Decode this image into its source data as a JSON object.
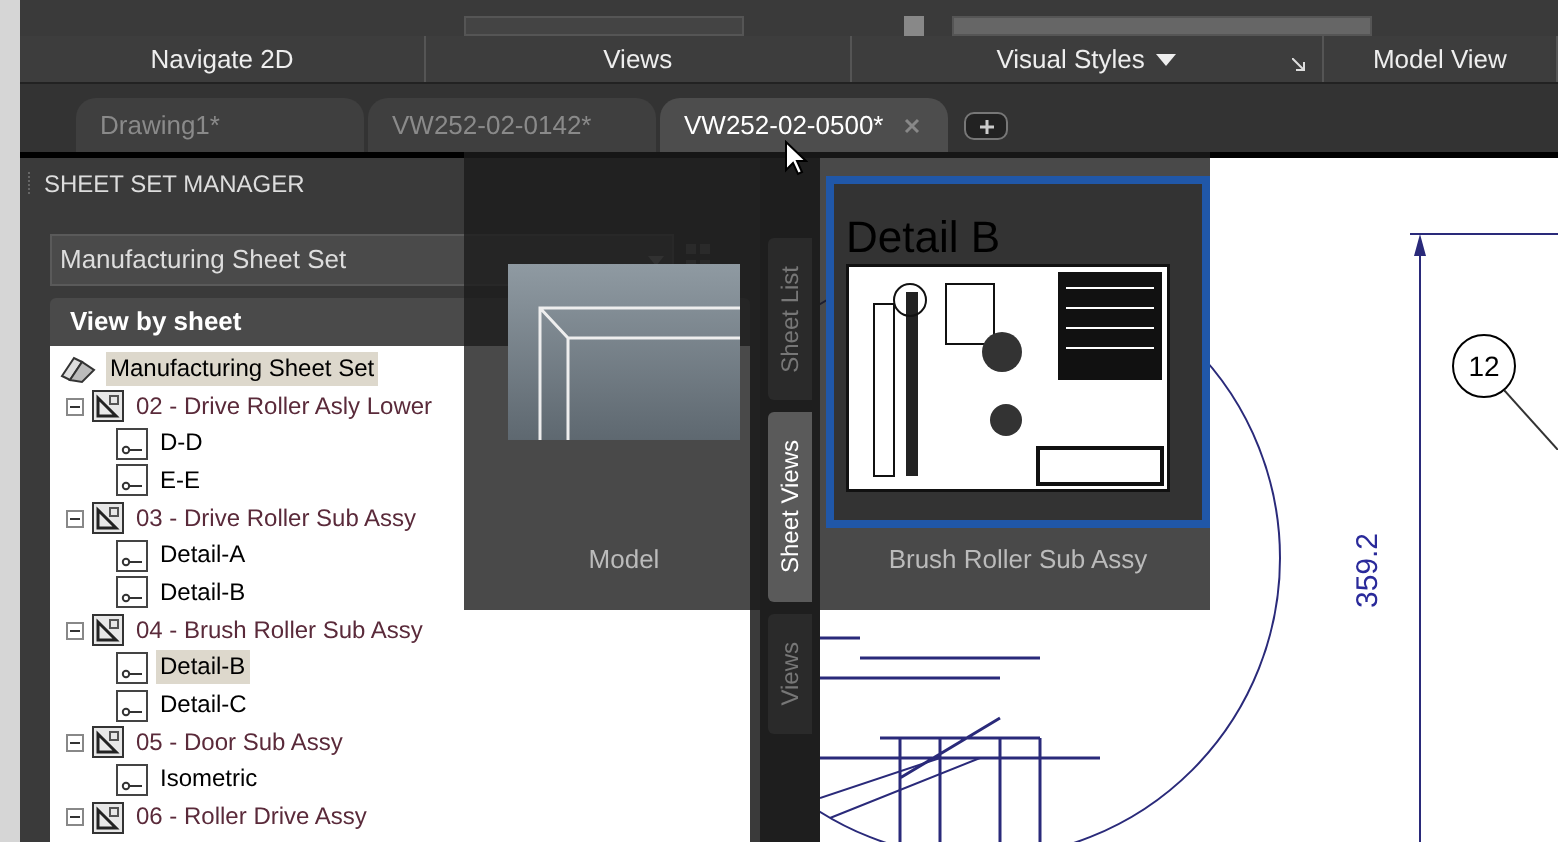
{
  "ribbon_panels": [
    {
      "label": "Navigate 2D",
      "dropdown": false,
      "launcher": false
    },
    {
      "label": "Views",
      "dropdown": false,
      "launcher": false
    },
    {
      "label": "Visual Styles",
      "dropdown": true,
      "launcher": true
    },
    {
      "label": "Model View",
      "dropdown": false,
      "launcher": false
    }
  ],
  "tabs": [
    {
      "label": "Drawing1*",
      "selected": false
    },
    {
      "label": "VW252-02-0142*",
      "selected": false
    },
    {
      "label": "VW252-02-0500*",
      "selected": true
    }
  ],
  "sheet_set_manager": {
    "title": "SHEET SET MANAGER",
    "sheet_set": "Manufacturing Sheet Set",
    "view_header": "View by sheet",
    "tree": [
      {
        "kind": "sheet-set",
        "label": "Manufacturing Sheet Set",
        "selected": true,
        "children": [
          {
            "kind": "sheet",
            "label": "02 - Drive Roller Asly Lower",
            "selected": false,
            "expanded": true,
            "children": [
              {
                "kind": "view",
                "label": "D-D",
                "selected": false
              },
              {
                "kind": "view",
                "label": "E-E",
                "selected": false
              }
            ]
          },
          {
            "kind": "sheet",
            "label": "03 - Drive Roller Sub Assy",
            "selected": false,
            "expanded": true,
            "children": [
              {
                "kind": "view",
                "label": "Detail-A",
                "selected": false
              },
              {
                "kind": "view",
                "label": "Detail-B",
                "selected": false
              }
            ]
          },
          {
            "kind": "sheet",
            "label": "04 - Brush Roller Sub Assy",
            "selected": false,
            "expanded": true,
            "children": [
              {
                "kind": "view",
                "label": "Detail-B",
                "selected": true
              },
              {
                "kind": "view",
                "label": "Detail-C",
                "selected": false
              }
            ]
          },
          {
            "kind": "sheet",
            "label": "05 - Door Sub Assy",
            "selected": false,
            "expanded": true,
            "children": [
              {
                "kind": "view",
                "label": "Isometric",
                "selected": false
              }
            ]
          },
          {
            "kind": "sheet",
            "label": "06 - Roller Drive Assy",
            "selected": false,
            "expanded": true
          }
        ]
      }
    ]
  },
  "side_tabs": [
    {
      "label": "Sheet List",
      "selected": false
    },
    {
      "label": "Sheet Views",
      "selected": true
    },
    {
      "label": "Views",
      "selected": false
    }
  ],
  "previews": [
    {
      "kind": "model",
      "label": "Model",
      "selected": false
    },
    {
      "kind": "layout",
      "label": "Brush Roller Sub Assy",
      "sheet_title": "Detail B",
      "selected": true
    }
  ],
  "drawing": {
    "balloon": "12",
    "dimension": "359.2"
  }
}
